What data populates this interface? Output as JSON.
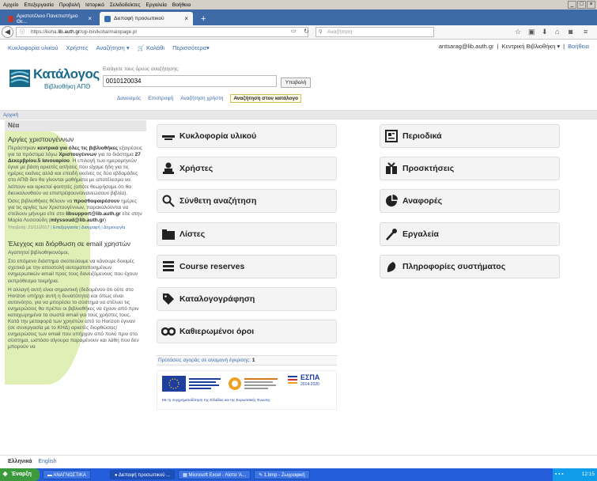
{
  "menubar": [
    "Αρχείο",
    "Επεξεργασία",
    "Προβολή",
    "Ιστορικό",
    "Σελιδοδείκτες",
    "Εργαλεία",
    "Βοήθεια"
  ],
  "browser_tabs": [
    {
      "title": "Αριστοτέλειο Πανεπιστήμιο Θε...",
      "active": false,
      "fav_color": "#c0392b"
    },
    {
      "title": "Διεπαφή προσωπικού",
      "active": true,
      "fav_color": "#3b6db2"
    }
  ],
  "url": {
    "prefix": "https://koha.",
    "host": "lib.auth.gr",
    "path": "/cgi-bin/koha/mainpage.pl"
  },
  "search_placeholder": "Αναζήτηση",
  "koha_nav": {
    "items": [
      "Κυκλοφορία υλικού",
      "Χρήστες",
      "Αναζήτηση"
    ],
    "cart": "Καλάθι",
    "more": "Περισσότερα"
  },
  "user": {
    "name": "antsarag@lib.auth.gr",
    "sep": "|",
    "branch": "Κεντρική Βιβλιοθήκη",
    "help": "Βοήθεια"
  },
  "logo": {
    "line1": "Κατάλογος",
    "line2": "Βιβλιοθήκη ΑΠΘ"
  },
  "search": {
    "label": "Εισάγετε τους όρους αναζήτησης:",
    "value": "0010120034",
    "submit": "Υποβολή"
  },
  "subtabs": [
    "Δανεισμός",
    "Επιστροφή",
    "Αναζήτηση χρήστη",
    "Αναζήτηση στον κατάλογο"
  ],
  "breadcrumb": "Αρχική",
  "news": {
    "header": "Νέα",
    "item1_title": "Αργίες χριστουγέννων",
    "item1_body_a": "Περάστηκαν ",
    "item1_bold_a": "κεντρικά για όλες τις βιβλιοθήκες",
    "item1_body_b": " εξαιρέσεις για τα πρόστιμα λόγω ",
    "item1_bold_b": "Χριστουγέννων",
    "item1_body_c": " για το διάστημα ",
    "item1_bold_c": "27 Δεκεμβρίου.5 Ιανουαρίου",
    "item1_body_d": ". Η επιλογή των ημερομηνιών έγινε με βάση αρκετές αιτήσεις που είχαμε ήδη για τις ημέρες εκείνες αλλά και επειδή εκείνες τις δύο εβδομάδες στο ΑΠΘ δεν θα γίνονται μαθήματα με αποτέλεσμα να λείπουν και αρκετοί φοιτητές (οπότε θεωρήσαμε ότι θα διευκολυνθούν να επιστρέψουν/ανανεώσουν βιβλία).",
    "item1_body_e": "Όσες βιβλιοθήκες θέλουν να ",
    "item1_bold_e": "προσθαφαιρέσουν",
    "item1_body_f": " ημέρες για τις αργίες των Χριστουγέννων, παρακαλούνται να στείλουν μήνυμα είτε στο ",
    "item1_bold_f": "libsupport@lib.auth.gr",
    "item1_body_g": " είτε στην Μαρία Λυσσούδη (",
    "item1_bold_g": "mlyssoud@lib.auth.gr",
    "item1_body_h": ")",
    "item1_meta": "Υποβολή: 21/11/2017",
    "item1_edit": "Επεξεργασία",
    "item1_delete": "Διαγραφή",
    "item1_create": "Δημιουργία",
    "item2_title": "Έλεγχος και διόρθωση σε email χρηστών",
    "item2_p1": "Αγαπητοί βιβλιοθηκονόμοι,",
    "item2_p2": "Στο επόμενο διάστημα σκοπεύουμε να κάνουμε δοκιμές σχετικά με την αποστολή αυτοματοποιημένων ενημερωτικών email προς τους δανειζόμενους που έχουν εκπρόθεσμα τεκμήρια.",
    "item2_p3": "Η αλλαγή αυτή είναι σημαντική (δεδομένου ότι ούτε στο Horizon υπήρχε αυτή η δυνατότητα) και όπως είναι αυτονόητο, για να μπορέσει το σύστημα να στέλνει τις ενημερώσεις θα πρέπει οι βιβλιοθήκες να έχουν από πριν καταχωρημένα τα σωστά email για τους χρήστες τους.",
    "item2_p4": "Κατά την μεταφορά των χρηστών από το Horizon έγιναν (σε συνεργασία με το ΚΗΔ) αρκετές διορθώσεις/ενημερώσεις των email που υπήρχαν από πολύ πριν στο σύστημα, ωστόσο σίγουρα παραμένουν και λάθη που δεν μπορούν να"
  },
  "modules_left": [
    {
      "label": "Κυκλοφορία υλικού",
      "icon": "circulation-icon"
    },
    {
      "label": "Χρήστες",
      "icon": "patrons-icon"
    },
    {
      "label": "Σύνθετη αναζήτηση",
      "icon": "search-icon"
    },
    {
      "label": "Λίστες",
      "icon": "lists-icon"
    },
    {
      "label": "Course reserves",
      "icon": "course-reserves-icon"
    },
    {
      "label": "Καταλογογράφηση",
      "icon": "cataloging-icon"
    },
    {
      "label": "Καθιερωμένοι όροι",
      "icon": "authorities-icon"
    }
  ],
  "modules_right": [
    {
      "label": "Περιοδικά",
      "icon": "serials-icon"
    },
    {
      "label": "Προσκτήσεις",
      "icon": "acquisitions-icon"
    },
    {
      "label": "Αναφορές",
      "icon": "reports-icon"
    },
    {
      "label": "Εργαλεία",
      "icon": "tools-icon"
    },
    {
      "label": "Πληροφορίες συστήματος",
      "icon": "about-icon"
    }
  ],
  "pending": {
    "text": "Προτάσεις αγοράς σε αναμονή έγκρισης:",
    "count": "1"
  },
  "banner": {
    "text": "Με τη συγχρηματοδότηση της Ελλάδας και της Ευρωπαϊκής Ένωσης",
    "espa": "ΕΣΠΑ",
    "espa_years": "2014-2020"
  },
  "langs": {
    "current": "Ελληνικά",
    "other": "English"
  },
  "taskbar": {
    "start": "Έναρξη",
    "tasks": [
      "ΑΝΑΓΝΩΣΤΙΚΑ",
      "Διεπαφή προσωπικού ...",
      "Microsoft Excel - Λίστα 'Α...",
      "1.bmp - Ζωγραφική"
    ],
    "clock": "12:15"
  }
}
